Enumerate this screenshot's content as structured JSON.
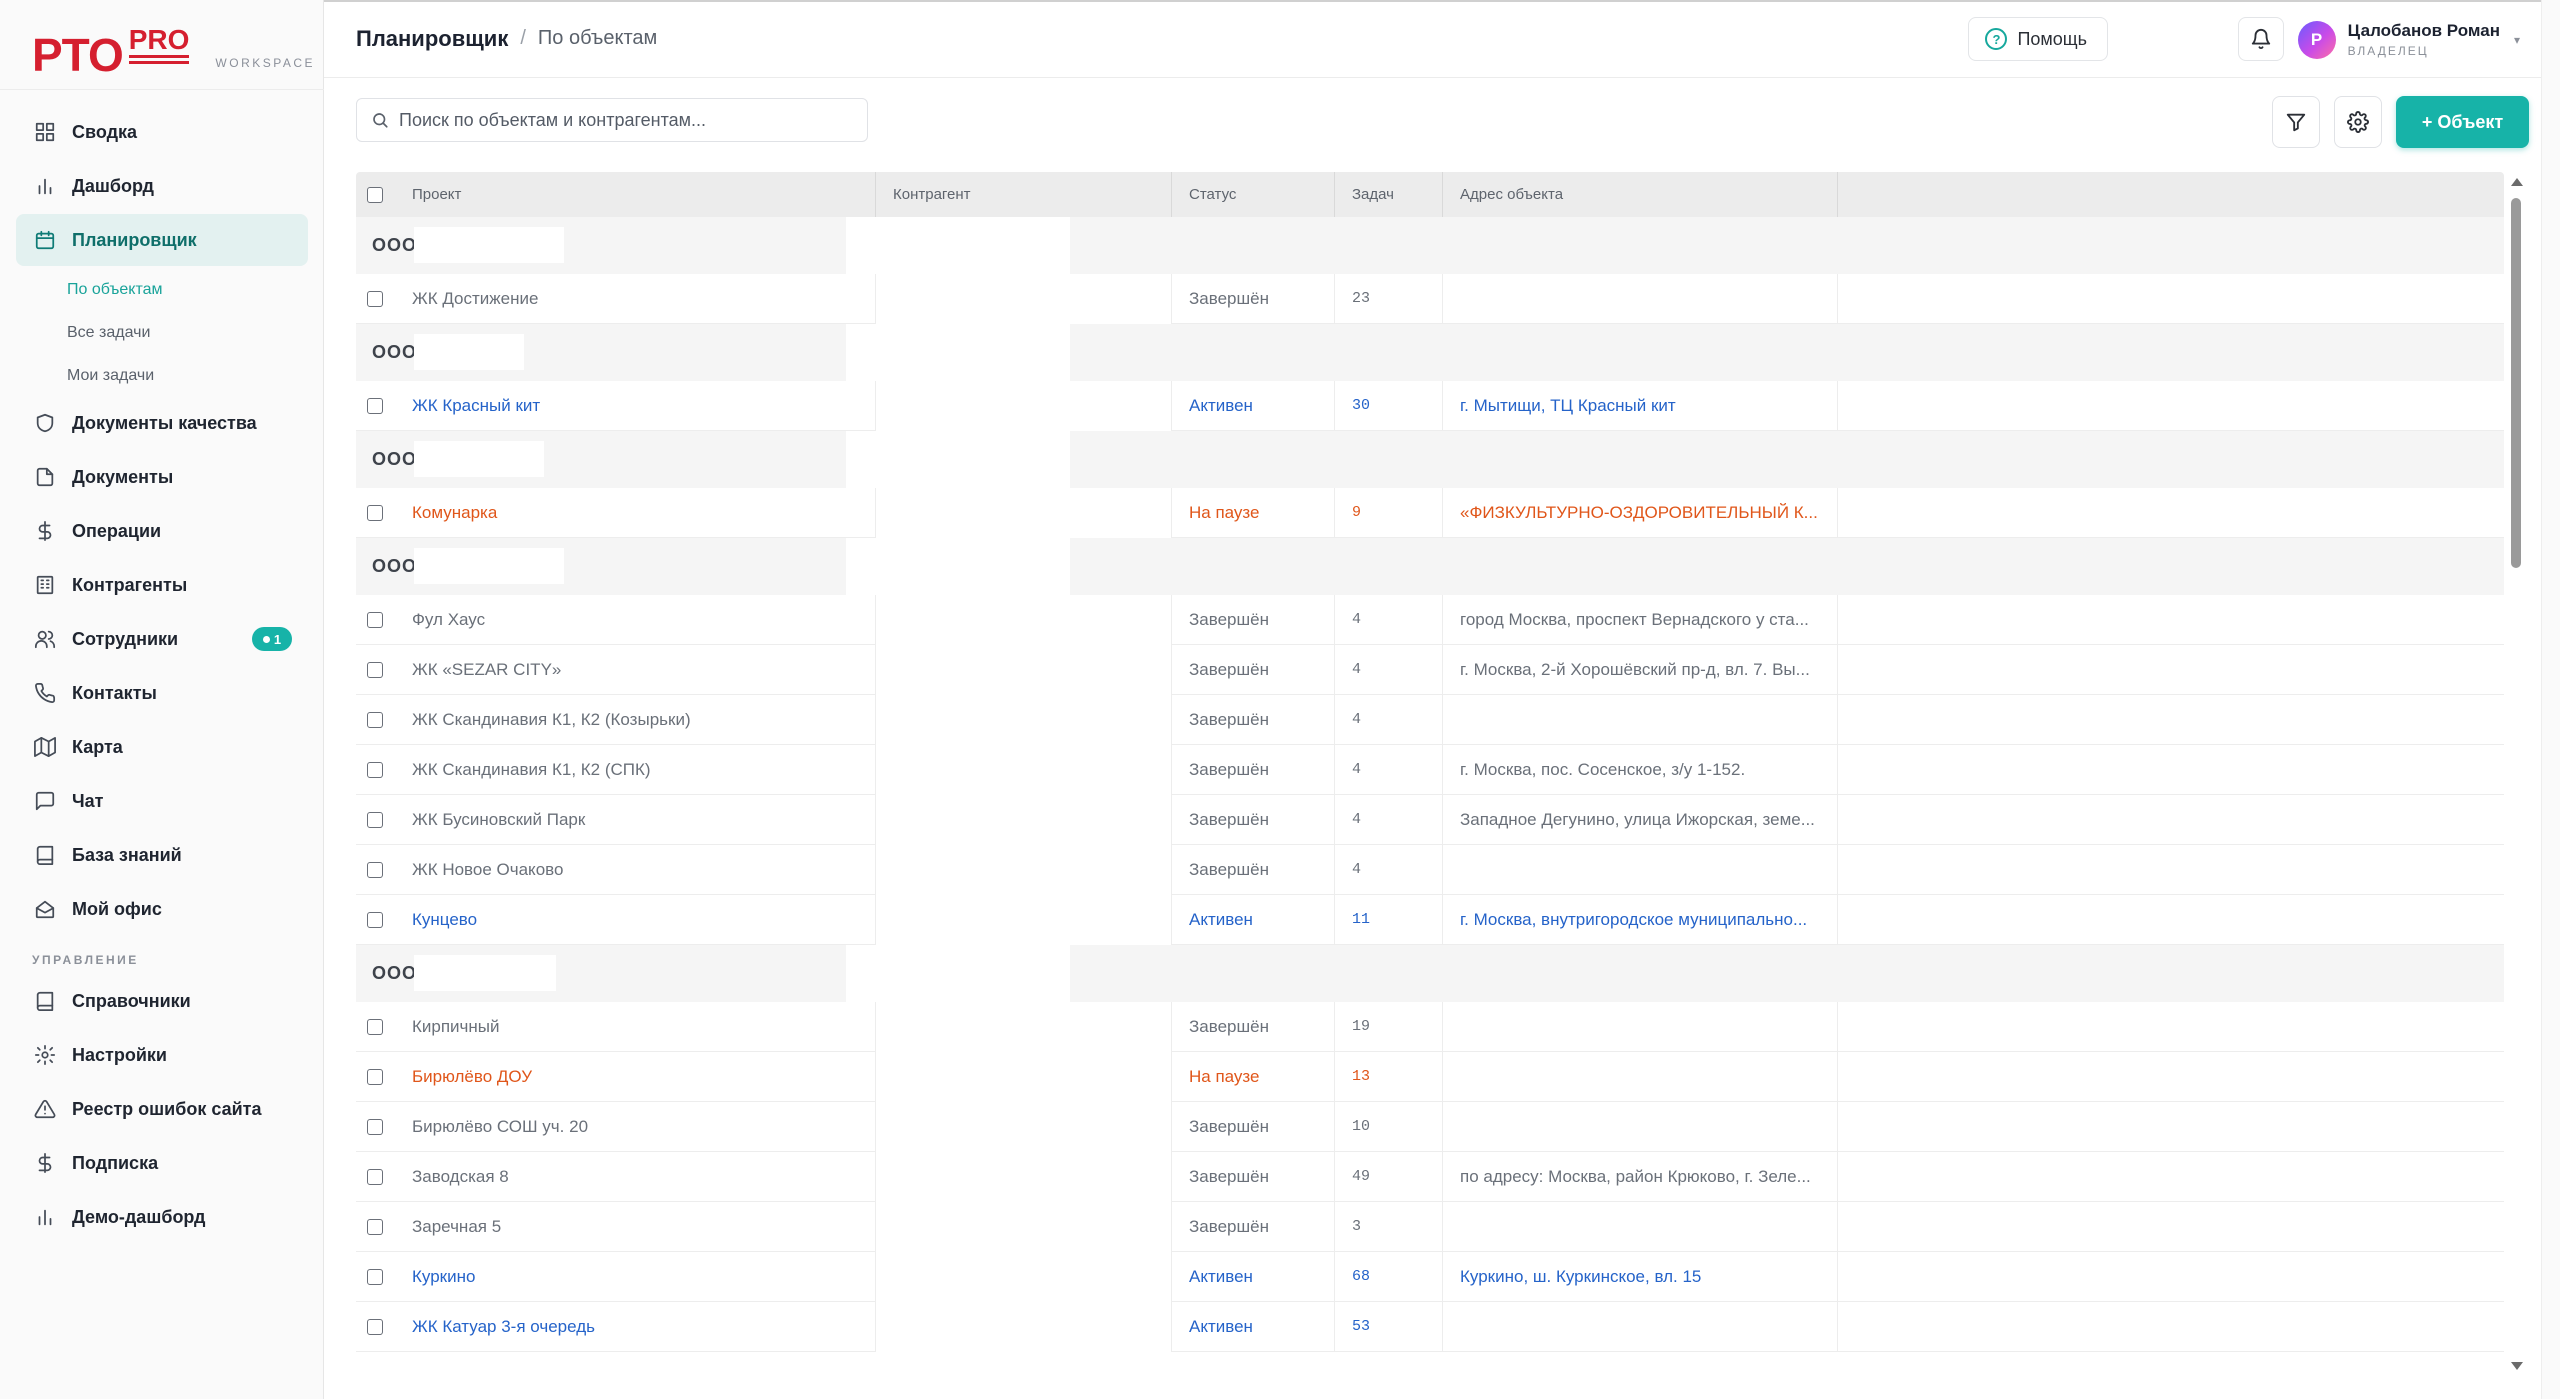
{
  "brand": {
    "logo_main": "PTO",
    "logo_pro": "PRO",
    "workspace": "WORKSPACE"
  },
  "sidebar": {
    "items": [
      {
        "label": "Сводка",
        "icon": "grid-icon"
      },
      {
        "label": "Дашборд",
        "icon": "bar-chart-icon"
      },
      {
        "label": "Планировщик",
        "icon": "calendar-icon",
        "active": true
      },
      {
        "label": "Документы качества",
        "icon": "shield-icon"
      },
      {
        "label": "Документы",
        "icon": "file-icon"
      },
      {
        "label": "Операции",
        "icon": "dollar-icon"
      },
      {
        "label": "Контрагенты",
        "icon": "building-icon"
      },
      {
        "label": "Сотрудники",
        "icon": "users-icon",
        "badge": "1"
      },
      {
        "label": "Контакты",
        "icon": "phone-icon"
      },
      {
        "label": "Карта",
        "icon": "map-icon"
      },
      {
        "label": "Чат",
        "icon": "chat-icon"
      },
      {
        "label": "База знаний",
        "icon": "book-icon"
      },
      {
        "label": "Мой офис",
        "icon": "office-icon"
      }
    ],
    "sub_items": [
      "По объектам",
      "Все задачи",
      "Мои задачи"
    ],
    "section_label": "УПРАВЛЕНИЕ",
    "admin_items": [
      {
        "label": "Справочники",
        "icon": "book-icon"
      },
      {
        "label": "Настройки",
        "icon": "gear-icon"
      },
      {
        "label": "Реестр ошибок сайта",
        "icon": "warning-icon"
      },
      {
        "label": "Подписка",
        "icon": "dollar-icon"
      },
      {
        "label": "Демо-дашборд",
        "icon": "bar-chart-icon"
      }
    ]
  },
  "header": {
    "title": "Планировщик",
    "separator": "/",
    "current": "По объектам",
    "help_label": "Помощь",
    "user_initial": "Р",
    "user_name": "Цалобанов Роман",
    "user_role": "ВЛАДЕЛЕЦ"
  },
  "toolbar": {
    "search_placeholder": "Поиск по объектам и контрагентам...",
    "add_label": "+ Объект"
  },
  "table": {
    "columns": [
      "Проект",
      "Контрагент",
      "Статус",
      "Задач",
      "Адрес объекта"
    ],
    "groups": [
      {
        "label": "ООО",
        "rows": [
          {
            "project": "ЖК Достижение",
            "status": "Завершён",
            "status_type": "done",
            "tasks": "23",
            "address": ""
          }
        ]
      },
      {
        "label": "ООО",
        "rows": [
          {
            "project": "ЖК Красный кит",
            "status": "Активен",
            "status_type": "active",
            "tasks": "30",
            "address": "г. Мытищи, ТЦ Красный кит"
          }
        ]
      },
      {
        "label": "ООО",
        "rows": [
          {
            "project": "Комунарка",
            "status": "На паузе",
            "status_type": "paused",
            "tasks": "9",
            "address": "«ФИЗКУЛЬТУРНО-ОЗДОРОВИТЕЛЬНЫЙ К..."
          }
        ]
      },
      {
        "label": "ООО",
        "rows": [
          {
            "project": "Фул Хаус",
            "status": "Завершён",
            "status_type": "done",
            "tasks": "4",
            "address": "город Москва, проспект Вернадского у ста..."
          },
          {
            "project": "ЖК «SEZAR CITY»",
            "status": "Завершён",
            "status_type": "done",
            "tasks": "4",
            "address": "г. Москва, 2-й Хорошёвский пр-д, вл. 7. Вы..."
          },
          {
            "project": "ЖК Скандинавия К1, К2 (Козырьки)",
            "status": "Завершён",
            "status_type": "done",
            "tasks": "4",
            "address": ""
          },
          {
            "project": "ЖК Скандинавия К1, К2 (СПК)",
            "status": "Завершён",
            "status_type": "done",
            "tasks": "4",
            "address": "г. Москва, пос. Сосенское, з/у 1-152."
          },
          {
            "project": "ЖК Бусиновский Парк",
            "status": "Завершён",
            "status_type": "done",
            "tasks": "4",
            "address": "Западное Дегунино, улица Ижорская, земе..."
          },
          {
            "project": "ЖК Новое Очаково",
            "status": "Завершён",
            "status_type": "done",
            "tasks": "4",
            "address": ""
          },
          {
            "project": "Кунцево",
            "status": "Активен",
            "status_type": "active",
            "tasks": "11",
            "address": "г. Москва, внутригородское муниципально..."
          }
        ]
      },
      {
        "label": "ООО",
        "rows": [
          {
            "project": "Кирпичный",
            "status": "Завершён",
            "status_type": "done",
            "tasks": "19",
            "address": ""
          },
          {
            "project": "Бирюлёво ДОУ",
            "status": "На паузе",
            "status_type": "paused",
            "tasks": "13",
            "address": ""
          },
          {
            "project": "Бирюлёво СОШ уч. 20",
            "status": "Завершён",
            "status_type": "done",
            "tasks": "10",
            "address": ""
          },
          {
            "project": "Заводская 8",
            "status": "Завершён",
            "status_type": "done",
            "tasks": "49",
            "address": "по адресу: Москва, район Крюково, г. Зеле..."
          },
          {
            "project": "Заречная 5",
            "status": "Завершён",
            "status_type": "done",
            "tasks": "3",
            "address": ""
          },
          {
            "project": "Куркино",
            "status": "Активен",
            "status_type": "active",
            "tasks": "68",
            "address": "Куркино, ш. Куркинское, вл. 15"
          },
          {
            "project": "ЖК Катуар 3-я очередь",
            "status": "Активен",
            "status_type": "active",
            "tasks": "53",
            "address": ""
          }
        ]
      }
    ]
  },
  "colors": {
    "accent": "#17b3a8",
    "brand": "#d51f2f",
    "status_active": "#2563c9",
    "status_paused": "#e0561a",
    "status_done": "#6a7079"
  }
}
